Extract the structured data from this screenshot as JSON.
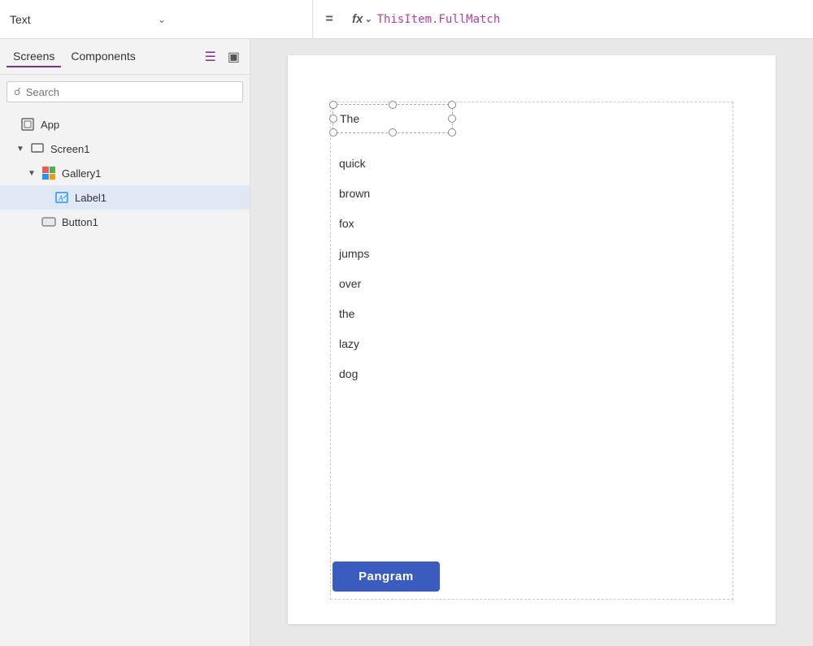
{
  "topbar": {
    "property_label": "Text",
    "equals": "=",
    "fx": "fx",
    "formula": "ThisItem.FullMatch"
  },
  "sidebar": {
    "tabs": [
      {
        "id": "screens",
        "label": "Screens",
        "active": true
      },
      {
        "id": "components",
        "label": "Components",
        "active": false
      }
    ],
    "search_placeholder": "Search",
    "tree": [
      {
        "id": "app",
        "label": "App",
        "level": 0,
        "type": "app",
        "expanded": true
      },
      {
        "id": "screen1",
        "label": "Screen1",
        "level": 1,
        "type": "screen",
        "expanded": true
      },
      {
        "id": "gallery1",
        "label": "Gallery1",
        "level": 2,
        "type": "gallery",
        "expanded": true
      },
      {
        "id": "label1",
        "label": "Label1",
        "level": 3,
        "type": "label",
        "selected": true
      },
      {
        "id": "button1",
        "label": "Button1",
        "level": 2,
        "type": "button"
      }
    ]
  },
  "canvas": {
    "selected_item_text": "The",
    "gallery_items": [
      "quick",
      "brown",
      "fox",
      "jumps",
      "over",
      "the",
      "lazy",
      "dog"
    ],
    "button_label": "Pangram"
  }
}
